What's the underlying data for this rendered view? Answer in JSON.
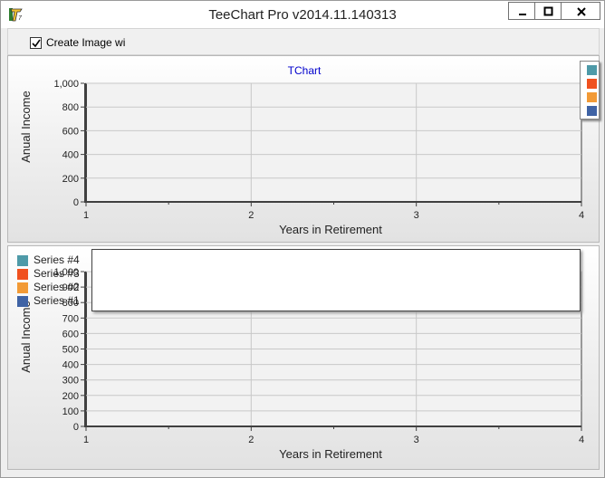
{
  "window": {
    "title": "TeeChart Pro v2014.11.140313",
    "app_icon": "teechart-logo-icon",
    "buttons": [
      "minimize-icon",
      "maximize-icon",
      "close-icon"
    ]
  },
  "toolbar": {
    "checkbox_label": "Create Image wi",
    "checkbox_checked": true
  },
  "colors": {
    "series4": "#4e9aa8",
    "series3": "#f0511f",
    "series2": "#f29a36",
    "series1": "#3f63a5",
    "title": "#0000cc"
  },
  "chart_data": [
    {
      "type": "line",
      "title": "TChart",
      "xlabel": "Years in Retirement",
      "ylabel": "Anual Income",
      "x_ticks": [
        "1",
        "2",
        "3",
        "4"
      ],
      "y_ticks": [
        "0",
        "200",
        "400",
        "600",
        "800",
        "1,000"
      ],
      "xlim": [
        1,
        4
      ],
      "ylim": [
        0,
        1000
      ],
      "grid": true,
      "legend_position": "right",
      "series": []
    },
    {
      "type": "line",
      "xlabel": "Years in Retirement",
      "ylabel": "Anual Income",
      "x_ticks": [
        "1",
        "2",
        "3",
        "4"
      ],
      "y_ticks": [
        "0",
        "100",
        "200",
        "300",
        "400",
        "500",
        "600",
        "700",
        "800",
        "900",
        "1,000"
      ],
      "xlim": [
        1,
        4
      ],
      "ylim": [
        0,
        1000
      ],
      "grid": true,
      "legend_position": "top-left",
      "legend": [
        "Series #4",
        "Series #3",
        "Series #2",
        "Series #1"
      ],
      "series": []
    }
  ]
}
